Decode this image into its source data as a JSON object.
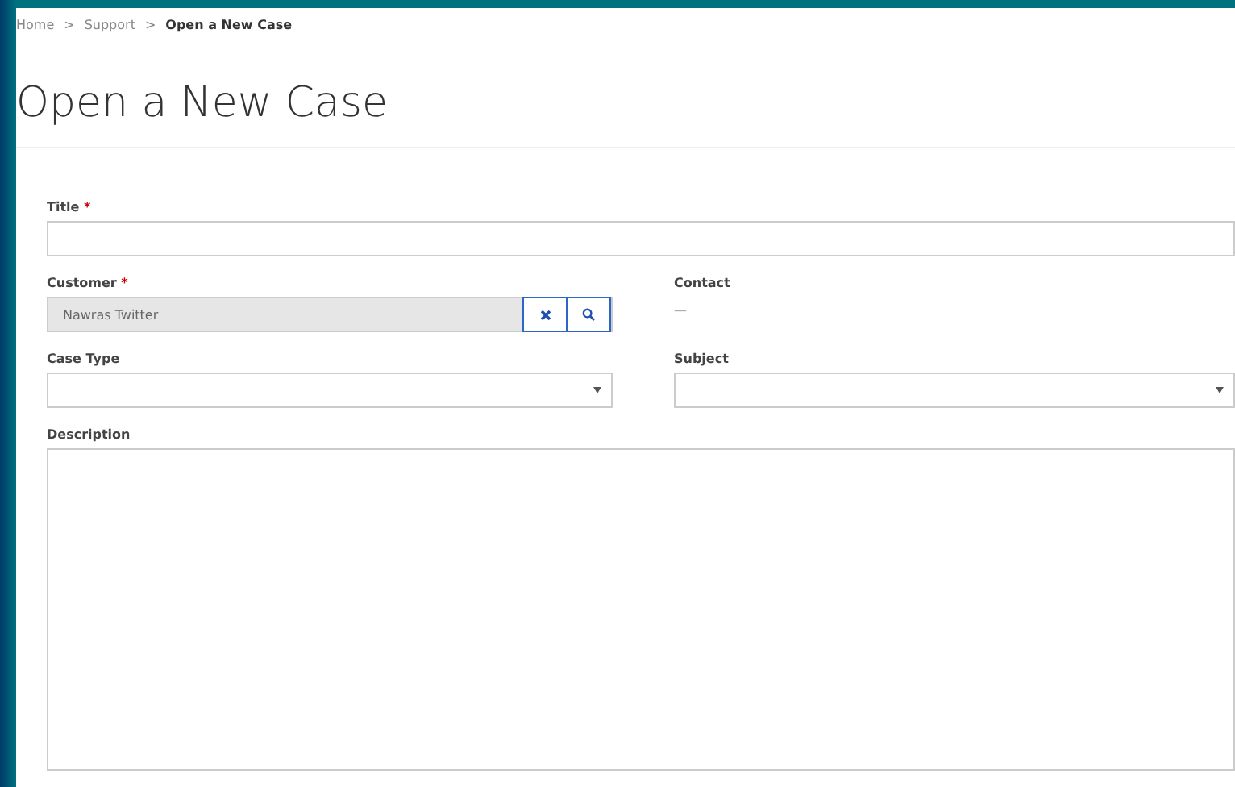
{
  "breadcrumb": [
    {
      "label": "Home",
      "current": false
    },
    {
      "label": "Support",
      "current": false
    },
    {
      "label": "Open a New Case",
      "current": true
    }
  ],
  "separator": ">",
  "heading": "Open a New Case",
  "fields": [
    {
      "kind": "text",
      "label": "Title",
      "required_mark": "*"
    },
    {
      "kind": "lookup",
      "label": "Customer",
      "required_mark": "*",
      "value": "Nawras Twitter"
    },
    {
      "kind": "readonly",
      "label": "Contact",
      "value": "—"
    },
    {
      "kind": "select",
      "label": "Case Type"
    },
    {
      "kind": "select",
      "label": "Subject"
    },
    {
      "kind": "textarea",
      "label": "Description"
    }
  ]
}
